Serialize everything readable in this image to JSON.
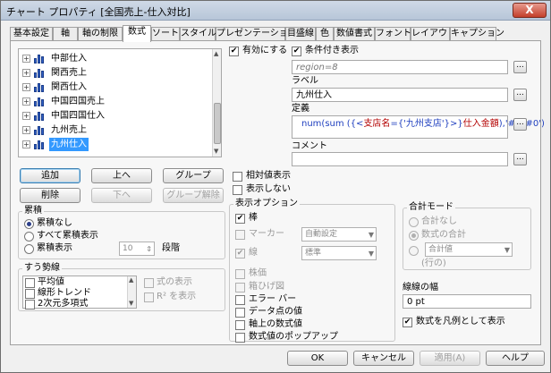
{
  "window": {
    "title": "チャート プロパティ [全国売上-仕入対比]",
    "close_label": "X"
  },
  "tabs": [
    {
      "label": "基本設定"
    },
    {
      "label": "軸"
    },
    {
      "label": "軸の制限"
    },
    {
      "label": "数式"
    },
    {
      "label": "ソート"
    },
    {
      "label": "スタイル"
    },
    {
      "label": "プレゼンテーション"
    },
    {
      "label": "目盛線"
    },
    {
      "label": "色"
    },
    {
      "label": "数値書式"
    },
    {
      "label": "フォント"
    },
    {
      "label": "レイアウト"
    },
    {
      "label": "キャプション"
    }
  ],
  "active_tab": "数式",
  "expressions": {
    "items": [
      {
        "label": "中部仕入",
        "selected": false
      },
      {
        "label": "関西売上",
        "selected": false
      },
      {
        "label": "関西仕入",
        "selected": false
      },
      {
        "label": "中国四国売上",
        "selected": false
      },
      {
        "label": "中国四国仕入",
        "selected": false
      },
      {
        "label": "九州売上",
        "selected": false
      },
      {
        "label": "九州仕入",
        "selected": true
      }
    ]
  },
  "buttons": {
    "add": "追加",
    "up": "上へ",
    "group": "グループ",
    "delete": "削除",
    "down": "下へ",
    "ungroup": "グループ解除",
    "ok": "OK",
    "cancel": "キャンセル",
    "apply": "適用(A)",
    "help": "ヘルプ",
    "dots": "..."
  },
  "enable": {
    "label": "有効にする",
    "checked": true
  },
  "conditional": {
    "label": "条件付き表示",
    "checked": true,
    "value": "region=8"
  },
  "label_field": {
    "caption": "ラベル",
    "value": "九州仕入"
  },
  "definition": {
    "caption": "定義",
    "parts": [
      {
        "text": "num(sum ({<",
        "color": "#1f3fbf"
      },
      {
        "text": "支店名",
        "color": "#b30000"
      },
      {
        "text": "={'九州支店'}>}",
        "color": "#1f3fbf"
      },
      {
        "text": "仕入金額",
        "color": "#b30000"
      },
      {
        "text": "),'#,##0')",
        "color": "#1f3fbf"
      }
    ]
  },
  "comment": {
    "caption": "コメント",
    "value": ""
  },
  "relative": {
    "label": "相対値表示",
    "checked": false
  },
  "invisible": {
    "label": "表示しない",
    "checked": false
  },
  "accumulation": {
    "title": "累積",
    "options": [
      {
        "label": "累積なし",
        "checked": true
      },
      {
        "label": "すべて累積表示",
        "checked": false
      },
      {
        "label": "累積表示",
        "checked": false
      }
    ],
    "steps_value": "10",
    "steps_label": "段階"
  },
  "trendline": {
    "title": "すう勢線",
    "items": [
      {
        "label": "平均値",
        "checked": false
      },
      {
        "label": "線形トレンド",
        "checked": false
      },
      {
        "label": "2次元多項式",
        "checked": false
      }
    ],
    "show_equation": "式の表示",
    "show_r2": "R² を表示"
  },
  "display_options": {
    "title": "表示オプション",
    "bar": {
      "label": "棒",
      "checked": true
    },
    "marker": {
      "label": "マーカー",
      "checked": false,
      "select": "自動設定"
    },
    "line": {
      "label": "線",
      "checked": true,
      "select": "標準"
    },
    "others": [
      {
        "label": "株価",
        "checked": false
      },
      {
        "label": "箱ひげ図",
        "checked": false
      },
      {
        "label": "エラー バー",
        "checked": false
      },
      {
        "label": "データ点の値",
        "checked": false
      },
      {
        "label": "軸上の数式値",
        "checked": false
      },
      {
        "label": "数式値のポップアップ",
        "checked": false
      }
    ]
  },
  "total_mode": {
    "title": "合計モード",
    "options": [
      {
        "label": "合計なし",
        "checked": false
      },
      {
        "label": "数式の合計",
        "checked": true
      },
      {
        "label": "",
        "checked": false
      }
    ],
    "select": "合計値",
    "suffix": "(行の)"
  },
  "line_width": {
    "caption": "線線の幅",
    "value": "0 pt"
  },
  "legend_style": {
    "label": "数式を凡例として表示",
    "checked": true
  }
}
